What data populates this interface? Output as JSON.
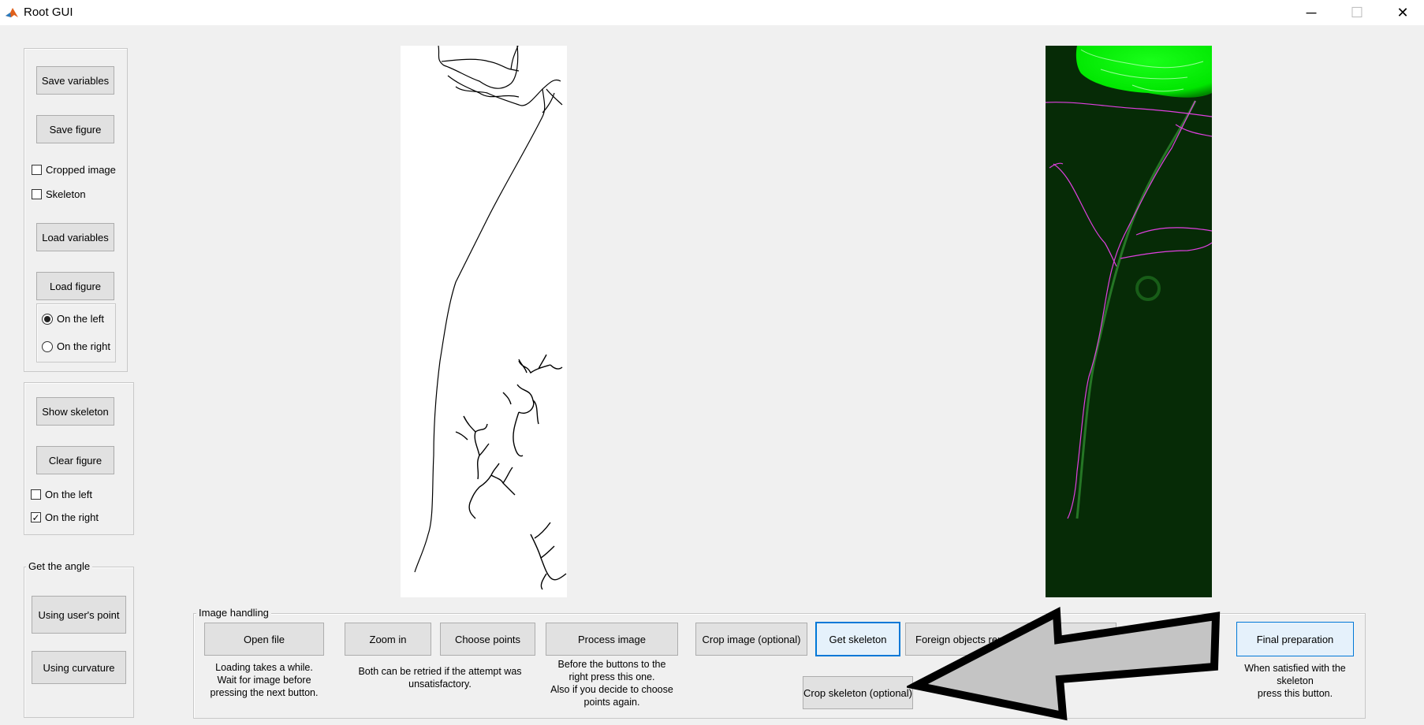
{
  "window": {
    "title": "Root GUI",
    "minimize_glyph": "─",
    "maximize_glyph": "☐",
    "close_glyph": "✕"
  },
  "left_panel": {
    "save_variables": "Save variables",
    "save_figure": "Save figure",
    "cropped_image": "Cropped image",
    "skeleton": "Skeleton",
    "load_variables": "Load variables",
    "load_figure": "Load figure",
    "on_the_left": "On the left",
    "on_the_right": "On the right"
  },
  "skeleton_panel": {
    "show_skeleton": "Show skeleton",
    "clear_figure": "Clear figure",
    "on_the_left": "On the left",
    "on_the_right": "On the right",
    "check_mark": "✓"
  },
  "angle_panel": {
    "title": "Get the angle",
    "using_users_point": "Using user's point",
    "using_curvature": "Using curvature"
  },
  "image_handling": {
    "title": "Image handling",
    "open_file": "Open file",
    "open_file_note": [
      "Loading takes a while.",
      "Wait for  image before",
      "pressing the next button."
    ],
    "zoom_in": "Zoom in",
    "choose_points": "Choose points",
    "retry_note": [
      "Both can be retried if the attempt was",
      "unsatisfactory."
    ],
    "process_image": "Process image",
    "process_note": [
      "Before the buttons to the",
      "right press this one.",
      "Also if you decide to choose",
      "points again."
    ],
    "crop_image": "Crop image (optional)",
    "get_skeleton": "Get skeleton",
    "foreign_objects": "Foreign objects rem",
    "crop_skeleton": "Crop skeleton (optional)",
    "final_preparation": "Final preparation",
    "final_note": [
      "When satisfied with the",
      "skeleton",
      "press this button."
    ]
  },
  "icons": [
    "matlab-logo-icon",
    "minimize-icon",
    "maximize-icon",
    "close-icon",
    "annotation-arrow-icon"
  ],
  "colors": {
    "skeleton_overlay": "#e040e0",
    "green_channel": "#00ff00",
    "accent": "#0078d7"
  }
}
